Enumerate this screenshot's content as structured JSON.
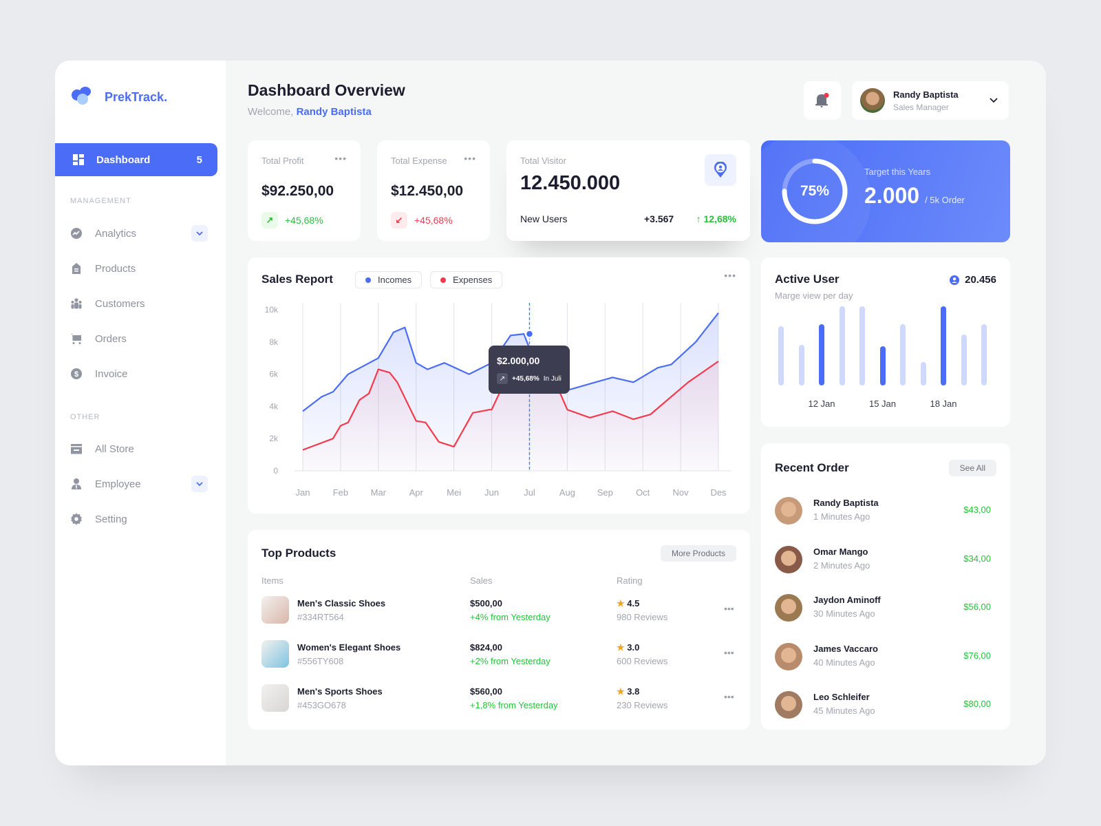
{
  "brand": {
    "name": "PrekTrack."
  },
  "sidebar": {
    "active": {
      "label": "Dashboard",
      "badge": "5"
    },
    "management_label": "MANAGEMENT",
    "management": [
      {
        "label": "Analytics",
        "icon": "analytics-icon",
        "expandable": true
      },
      {
        "label": "Products",
        "icon": "products-icon",
        "expandable": false
      },
      {
        "label": "Customers",
        "icon": "customers-icon",
        "expandable": false
      },
      {
        "label": "Orders",
        "icon": "cart-icon",
        "expandable": false
      },
      {
        "label": "Invoice",
        "icon": "invoice-icon",
        "expandable": false
      }
    ],
    "other_label": "OTHER",
    "other": [
      {
        "label": "All Store",
        "icon": "store-icon",
        "expandable": false
      },
      {
        "label": "Employee",
        "icon": "employee-icon",
        "expandable": true
      },
      {
        "label": "Setting",
        "icon": "gear-icon",
        "expandable": false
      }
    ]
  },
  "header": {
    "title": "Dashboard Overview",
    "welcome_prefix": "Welcome,",
    "welcome_name": "Randy Baptista",
    "user": {
      "name": "Randy Baptista",
      "role": "Sales Manager"
    }
  },
  "stats": {
    "profit": {
      "label": "Total Profit",
      "value": "$92.250,00",
      "change": "+45,68%"
    },
    "expense": {
      "label": "Total Expense",
      "value": "$12.450,00",
      "change": "+45,68%"
    },
    "visitor": {
      "label": "Total Visitor",
      "value": "12.450.000",
      "sub_label": "New Users",
      "sub_value": "+3.567",
      "sub_change": "12,68%"
    },
    "target": {
      "label": "Target this Years",
      "value": "2.000",
      "unit": "/ 5k Order",
      "percent_label": "75%",
      "progress": 0.75
    }
  },
  "sales_report": {
    "title": "Sales Report",
    "tooltip": {
      "value": "$2.000,00",
      "change": "+45,68%",
      "period": "In Juli"
    }
  },
  "chart_data": {
    "type": "area",
    "title": "Sales Report",
    "categories": [
      "Jan",
      "Feb",
      "Mar",
      "Apr",
      "Mei",
      "Jun",
      "Jul",
      "Aug",
      "Sep",
      "Oct",
      "Nov",
      "Des"
    ],
    "yticks": [
      "0",
      "2k",
      "4k",
      "6k",
      "8k",
      "10k"
    ],
    "ylim": [
      0,
      10000
    ],
    "series": [
      {
        "name": "Incomes",
        "color": "#4a6cf7",
        "x": [
          0,
          0.5,
          0.8,
          1.2,
          2,
          2.4,
          2.7,
          3,
          3.3,
          3.75,
          4.4,
          5,
          5.5,
          5.85,
          6,
          6.4,
          7,
          7.6,
          8.2,
          8.75,
          9.4,
          9.75,
          10.4,
          10.7,
          11
        ],
        "y": [
          3700,
          4600,
          4900,
          6000,
          7000,
          8600,
          8900,
          6700,
          6300,
          6700,
          6000,
          6700,
          8400,
          8500,
          7600,
          6000,
          5000,
          5400,
          5800,
          5500,
          6400,
          6600,
          8000,
          8900,
          9800
        ]
      },
      {
        "name": "Expenses",
        "color": "#f23a4c",
        "x": [
          0,
          0.8,
          1,
          1.2,
          1.5,
          1.75,
          2,
          2.3,
          2.5,
          3,
          3.25,
          3.6,
          4,
          4.5,
          4.95,
          5,
          5.5,
          6,
          6.5,
          7,
          7.6,
          8.2,
          8.75,
          9.2,
          9.75,
          10.2,
          11
        ],
        "y": [
          1300,
          2000,
          2800,
          3000,
          4400,
          4800,
          6300,
          6100,
          5500,
          3100,
          3000,
          1800,
          1500,
          3600,
          3800,
          3800,
          6300,
          7000,
          6500,
          3800,
          3300,
          3700,
          3200,
          3500,
          4600,
          5500,
          6800
        ]
      }
    ],
    "highlight": {
      "category": "Jul",
      "value": 8500
    },
    "legend": "top-left"
  },
  "active_user": {
    "title": "Active User",
    "subtitle": "Marge view per day",
    "count": "20.456",
    "bars": [
      0.64,
      0.44,
      0.66,
      0.85,
      0.85,
      0.42,
      0.66,
      0.25,
      0.85,
      0.55,
      0.66
    ],
    "highlighted": [
      2,
      5,
      8
    ],
    "labels": [
      {
        "index": 2,
        "text": "12 Jan"
      },
      {
        "index": 5,
        "text": "15 Jan"
      },
      {
        "index": 8,
        "text": "18 Jan"
      }
    ]
  },
  "top_products": {
    "title": "Top Products",
    "more_label": "More Products",
    "columns": [
      "Items",
      "Sales",
      "Rating"
    ],
    "rows": [
      {
        "name": "Men's Classic Shoes",
        "sku": "#334RT564",
        "sales": "$500,00",
        "change": "+4% from Yesterday",
        "rating": "4.5",
        "reviews": "980 Reviews",
        "thumb": "#d9b6a8"
      },
      {
        "name": "Women's Elegant Shoes",
        "sku": "#556TY608",
        "sales": "$824,00",
        "change": "+2% from Yesterday",
        "rating": "3.0",
        "reviews": "600 Reviews",
        "thumb": "#7fc3e0"
      },
      {
        "name": "Men's Sports Shoes",
        "sku": "#453GO678",
        "sales": "$560,00",
        "change": "+1,8% from Yesterday",
        "rating": "3.8",
        "reviews": "230 Reviews",
        "thumb": "#d8d6d3"
      }
    ]
  },
  "recent_order": {
    "title": "Recent Order",
    "see_all": "See All",
    "rows": [
      {
        "name": "Randy Baptista",
        "time": "1 Minutes Ago",
        "amount": "$43,00",
        "avatar": "#c79b7a"
      },
      {
        "name": "Omar Mango",
        "time": "2 Minutes Ago",
        "amount": "$34,00",
        "avatar": "#8a5a48"
      },
      {
        "name": "Jaydon Aminoff",
        "time": "30 Minutes Ago",
        "amount": "$56,00",
        "avatar": "#9b7a52"
      },
      {
        "name": "James Vaccaro",
        "time": "40 Minutes Ago",
        "amount": "$76,00",
        "avatar": "#b88b6c"
      },
      {
        "name": "Leo Schleifer",
        "time": "45 Minutes Ago",
        "amount": "$80,00",
        "avatar": "#a17a62"
      }
    ]
  }
}
